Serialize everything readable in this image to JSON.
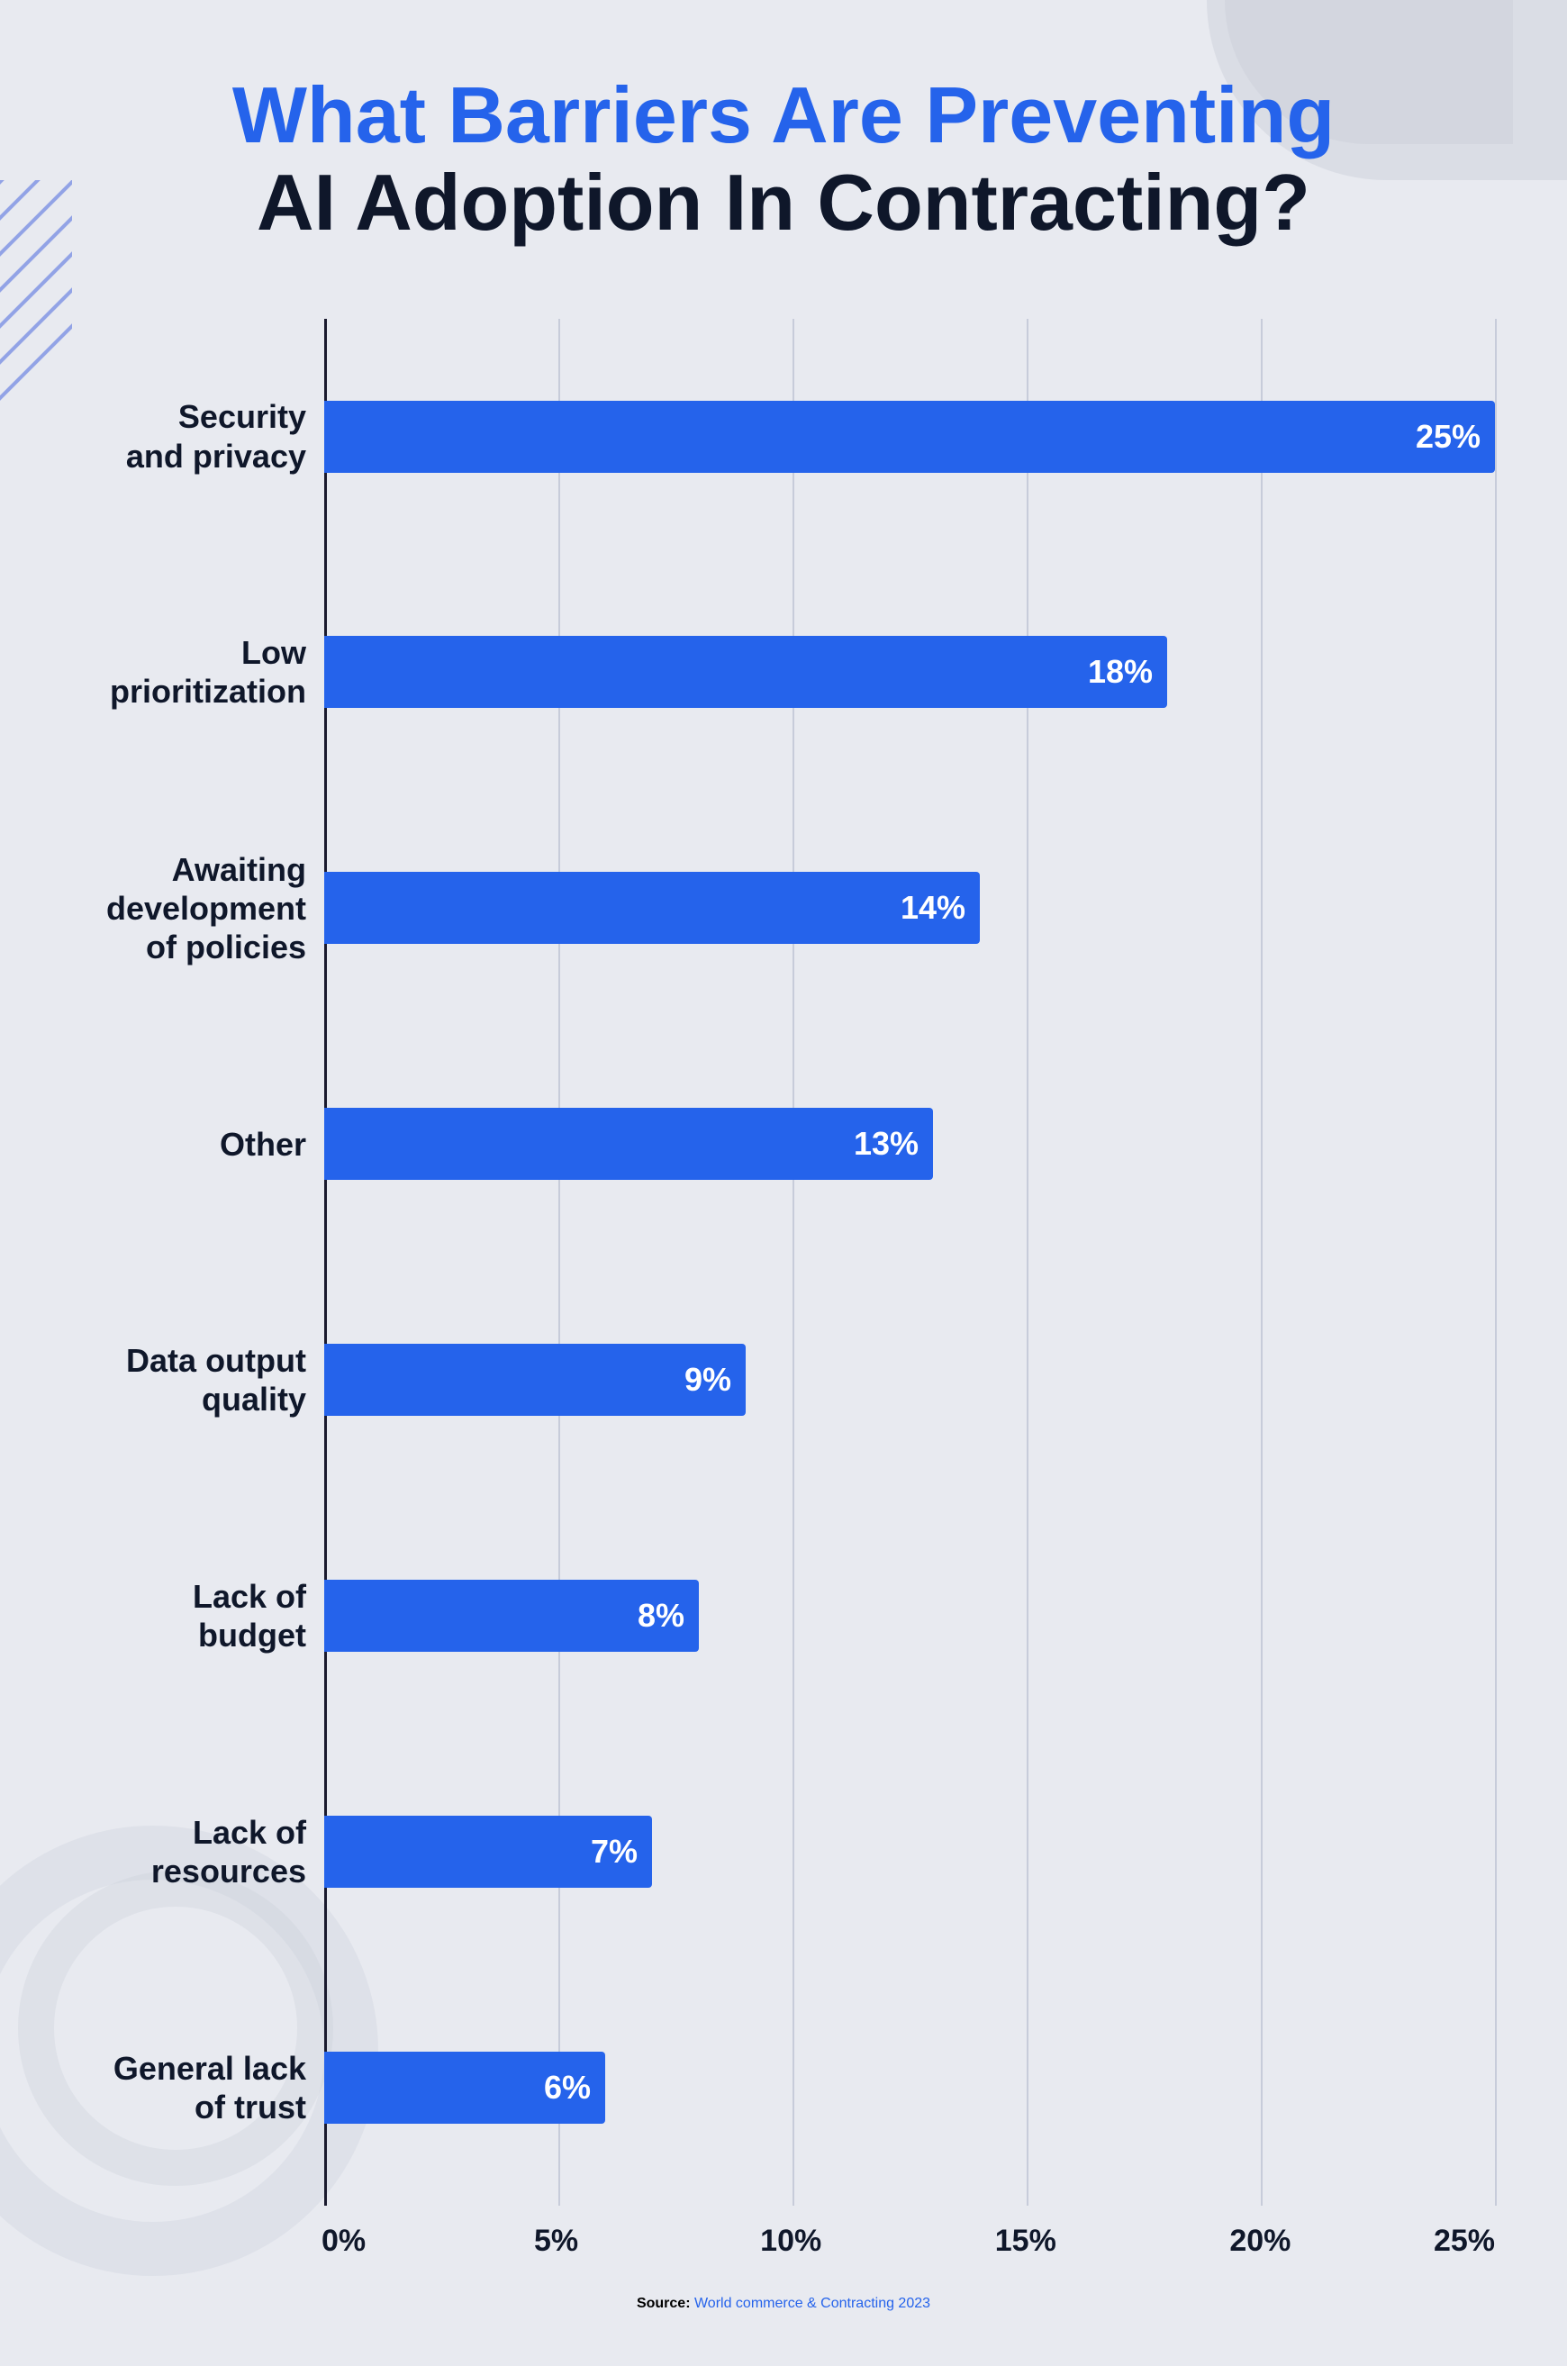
{
  "title": {
    "line1": "What Barriers Are Preventing",
    "line2": "AI Adoption In Contracting?"
  },
  "chart": {
    "bars": [
      {
        "label": "Security\nand privacy",
        "value": 25,
        "display": "25%",
        "pct": 100
      },
      {
        "label": "Low\nprioritization",
        "value": 18,
        "display": "18%",
        "pct": 72
      },
      {
        "label": "Awaiting\ndevelopment\nof policies",
        "value": 14,
        "display": "14%",
        "pct": 56
      },
      {
        "label": "Other",
        "value": 13,
        "display": "13%",
        "pct": 52
      },
      {
        "label": "Data output\nquality",
        "value": 9,
        "display": "9%",
        "pct": 36
      },
      {
        "label": "Lack of\nbudget",
        "value": 8,
        "display": "8%",
        "pct": 32
      },
      {
        "label": "Lack of\nresources",
        "value": 7,
        "display": "7%",
        "pct": 28
      },
      {
        "label": "General lack\nof trust",
        "value": 6,
        "display": "6%",
        "pct": 24
      }
    ],
    "x_labels": [
      "0%",
      "5%",
      "10%",
      "15%",
      "20%",
      "25%"
    ],
    "max_value": 25
  },
  "source": {
    "prefix": "Source:",
    "text": "World commerce & Contracting 2023"
  },
  "colors": {
    "bar": "#2563eb",
    "title_blue": "#2563eb",
    "title_dark": "#0f172a",
    "grid": "#b0b8cc",
    "axis": "#1a1a2e",
    "text_dark": "#0f172a",
    "link": "#2563eb"
  }
}
